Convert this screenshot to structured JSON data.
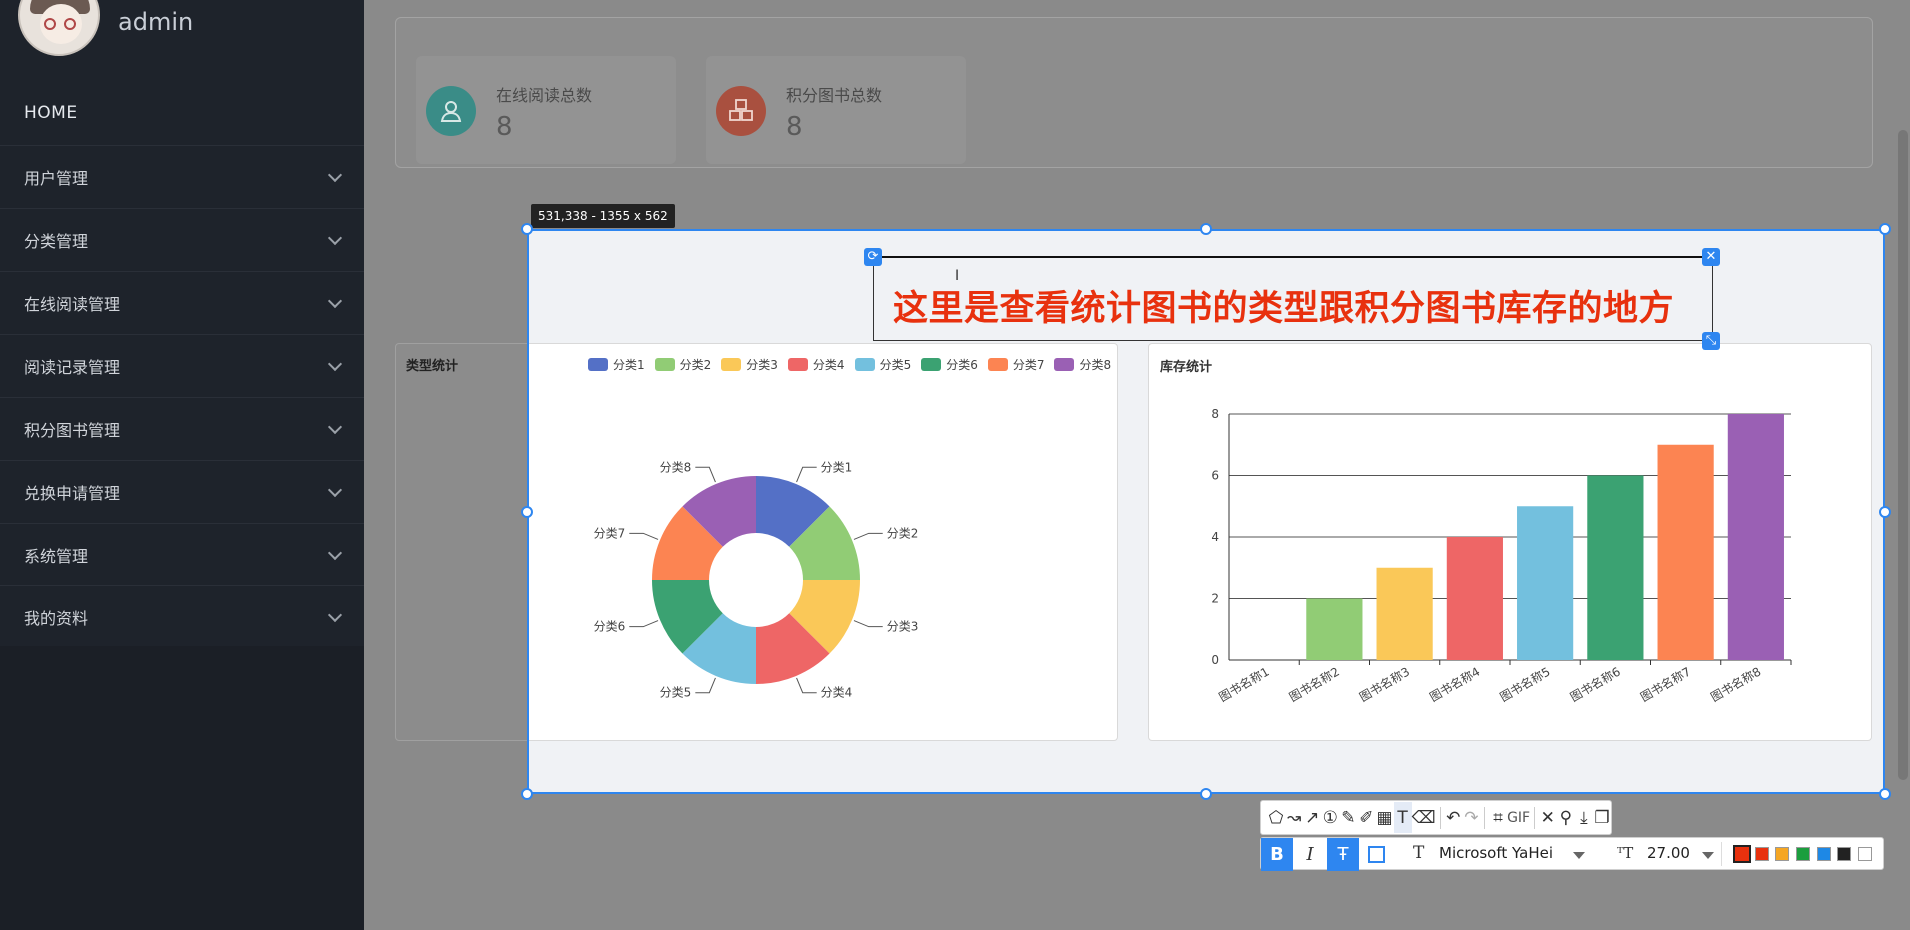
{
  "user": {
    "name": "admin"
  },
  "nav": {
    "home": "HOME",
    "items": [
      {
        "label": "用户管理"
      },
      {
        "label": "分类管理"
      },
      {
        "label": "在线阅读管理"
      },
      {
        "label": "阅读记录管理"
      },
      {
        "label": "积分图书管理"
      },
      {
        "label": "兑换申请管理"
      },
      {
        "label": "系统管理"
      },
      {
        "label": "我的资料"
      }
    ]
  },
  "stats": [
    {
      "label": "在线阅读总数",
      "value": "8",
      "icon": "user-icon",
      "color": "#3ba7a0"
    },
    {
      "label": "积分图书总数",
      "value": "8",
      "icon": "cubes-icon",
      "color": "#d9553a"
    }
  ],
  "capture": {
    "size_readout": "531,338 - 1355 x 562",
    "annotation_text": "这里是查看统计图书的类型跟积分图书库存的地方"
  },
  "toolbar": {
    "font_name": "Microsoft YaHei",
    "font_size": "27.00",
    "gif_label": "GIF",
    "colors": [
      "#e8310e",
      "#f5a623",
      "#1b9e3e",
      "#1e88e5",
      "#222222",
      "#ffffff"
    ]
  },
  "chart_data": [
    {
      "type": "pie",
      "title": "类型统计",
      "donut": true,
      "legend_position": "top-right",
      "categories": [
        "分类1",
        "分类2",
        "分类3",
        "分类4",
        "分类5",
        "分类6",
        "分类7",
        "分类8"
      ],
      "values": [
        1,
        1,
        1,
        1,
        1,
        1,
        1,
        1
      ],
      "colors": [
        "#5470c6",
        "#91cc75",
        "#fac858",
        "#ee6666",
        "#73c0de",
        "#3ba272",
        "#fc8452",
        "#9a60b4"
      ]
    },
    {
      "type": "bar",
      "title": "库存统计",
      "categories": [
        "图书名称1",
        "图书名称2",
        "图书名称3",
        "图书名称4",
        "图书名称5",
        "图书名称6",
        "图书名称7",
        "图书名称8"
      ],
      "values": [
        0,
        2,
        3,
        4,
        5,
        6,
        7,
        8
      ],
      "ylim": [
        0,
        8
      ],
      "yticks": [
        0,
        2,
        4,
        6,
        8
      ],
      "grid": true,
      "colors": [
        "#5470c6",
        "#91cc75",
        "#fac858",
        "#ee6666",
        "#73c0de",
        "#3ba272",
        "#fc8452",
        "#9a60b4"
      ]
    }
  ]
}
